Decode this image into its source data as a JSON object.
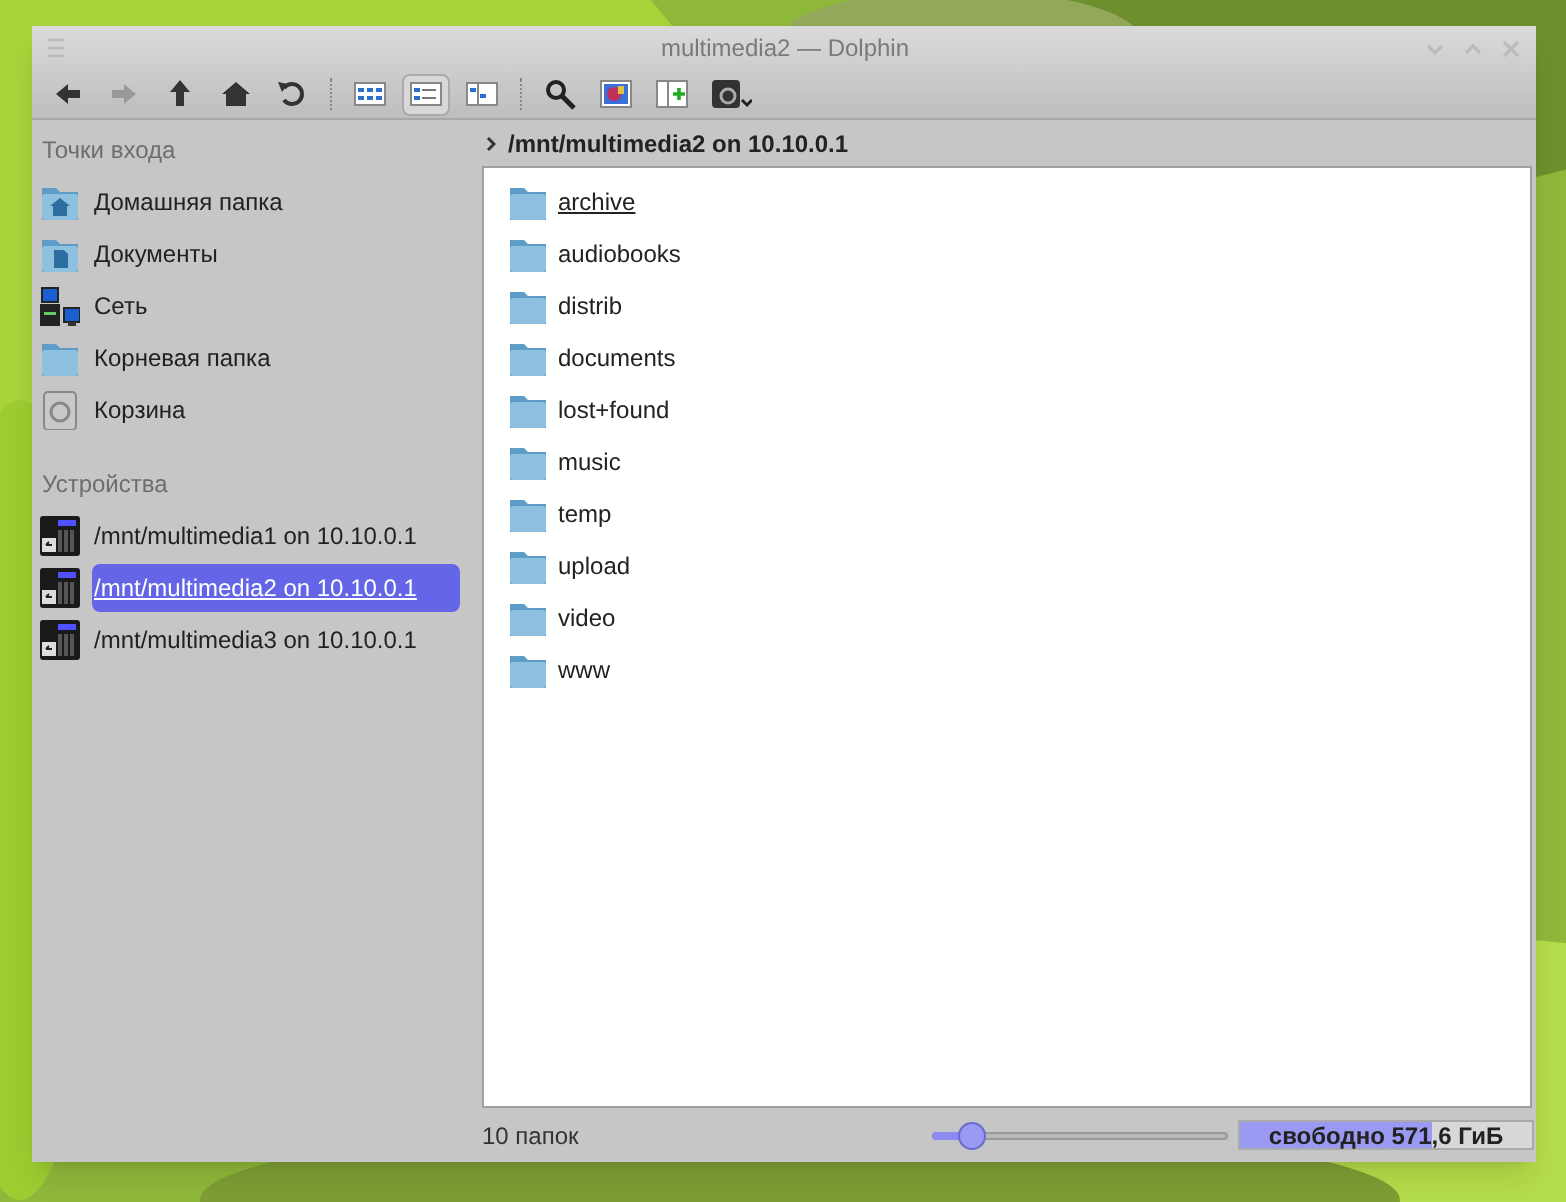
{
  "window": {
    "title": "multimedia2 — Dolphin"
  },
  "toolbar": [
    {
      "kind": "back",
      "disabled": false
    },
    {
      "kind": "forward",
      "disabled": true
    },
    {
      "kind": "up",
      "disabled": false
    },
    {
      "kind": "home",
      "disabled": false
    },
    {
      "kind": "reload",
      "disabled": false
    },
    {
      "kind": "separator"
    },
    {
      "kind": "icons-view",
      "selected": false
    },
    {
      "kind": "details-view",
      "selected": true
    },
    {
      "kind": "columns-view",
      "selected": false
    },
    {
      "kind": "separator"
    },
    {
      "kind": "search"
    },
    {
      "kind": "preview"
    },
    {
      "kind": "split"
    },
    {
      "kind": "terminal"
    }
  ],
  "sidebar": {
    "sections": [
      {
        "title": "Точки входа",
        "items": [
          {
            "label": "Домашняя папка",
            "kind": "home",
            "selected": false
          },
          {
            "label": "Документы",
            "kind": "documents",
            "selected": false
          },
          {
            "label": "Сеть",
            "kind": "network",
            "selected": false
          },
          {
            "label": "Корневая папка",
            "kind": "folder",
            "selected": false
          },
          {
            "label": "Корзина",
            "kind": "trash",
            "selected": false
          }
        ]
      },
      {
        "title": "Устройства",
        "items": [
          {
            "label": "/mnt/multimedia1 on 10.10.0.1",
            "kind": "nas",
            "selected": false
          },
          {
            "label": "/mnt/multimedia2 on 10.10.0.1",
            "kind": "nas",
            "selected": true
          },
          {
            "label": "/mnt/multimedia3 on 10.10.0.1",
            "kind": "nas",
            "selected": false
          }
        ]
      }
    ]
  },
  "location": {
    "path": "/mnt/multimedia2 on 10.10.0.1"
  },
  "files": [
    {
      "name": "archive",
      "hovered": true
    },
    {
      "name": "audiobooks",
      "hovered": false
    },
    {
      "name": "distrib",
      "hovered": false
    },
    {
      "name": "documents",
      "hovered": false
    },
    {
      "name": "lost+found",
      "hovered": false
    },
    {
      "name": "music",
      "hovered": false
    },
    {
      "name": "temp",
      "hovered": false
    },
    {
      "name": "upload",
      "hovered": false
    },
    {
      "name": "video",
      "hovered": false
    },
    {
      "name": "www",
      "hovered": false
    }
  ],
  "status_bar": {
    "count": "10 папок",
    "zoom": {
      "level": 0.1
    },
    "free_space": {
      "text": "свободно 571,6 ГиБ",
      "level": 0.66
    }
  }
}
